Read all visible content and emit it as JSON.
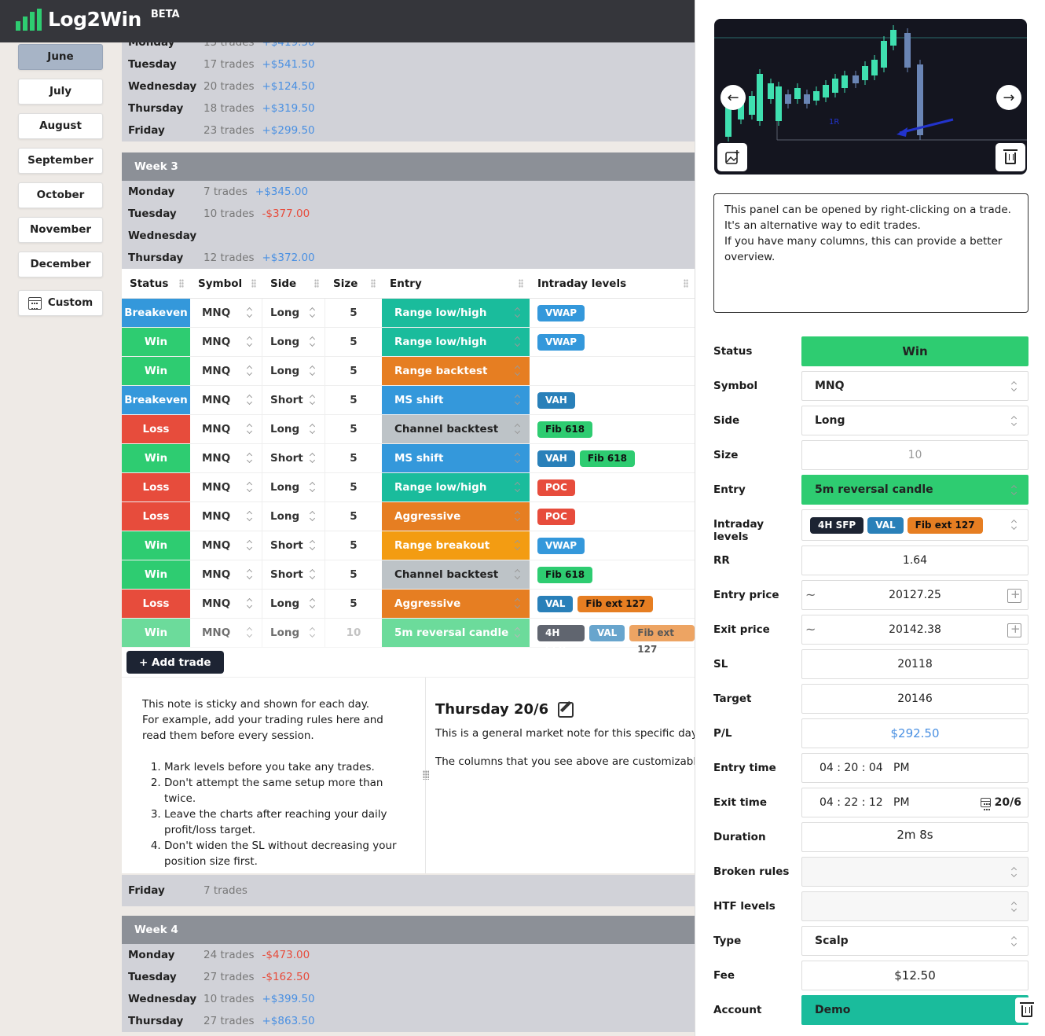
{
  "app": {
    "name": "Log2Win",
    "badge": "BETA"
  },
  "months": [
    {
      "label": "June",
      "active": true
    },
    {
      "label": "July",
      "active": false
    },
    {
      "label": "August",
      "active": false
    },
    {
      "label": "September",
      "active": false
    },
    {
      "label": "October",
      "active": false
    },
    {
      "label": "November",
      "active": false
    },
    {
      "label": "December",
      "active": false
    }
  ],
  "custom_label": "Custom",
  "week2_days": [
    {
      "day": "Monday",
      "trades": "15 trades",
      "pl": "+$419.50"
    },
    {
      "day": "Tuesday",
      "trades": "17 trades",
      "pl": "+$541.50"
    },
    {
      "day": "Wednesday",
      "trades": "20 trades",
      "pl": "+$124.50"
    },
    {
      "day": "Thursday",
      "trades": "18 trades",
      "pl": "+$319.50"
    },
    {
      "day": "Friday",
      "trades": "23 trades",
      "pl": "+$299.50"
    }
  ],
  "week3": {
    "title": "Week 3",
    "days": [
      {
        "day": "Monday",
        "trades": "7 trades",
        "pl": "+$345.00",
        "neg": false
      },
      {
        "day": "Tuesday",
        "trades": "10 trades",
        "pl": "-$377.00",
        "neg": true
      },
      {
        "day": "Wednesday",
        "trades": "",
        "pl": "",
        "neg": false
      },
      {
        "day": "Thursday",
        "trades": "12 trades",
        "pl": "+$372.00",
        "neg": false
      }
    ]
  },
  "table": {
    "headers": [
      "Status",
      "Symbol",
      "Side",
      "Size",
      "Entry",
      "Intraday levels"
    ],
    "rows": [
      {
        "status": "Breakeven",
        "symbol": "MNQ",
        "side": "Long",
        "size": "5",
        "entry": "Range low/high",
        "levels": [
          "VWAP"
        ]
      },
      {
        "status": "Win",
        "symbol": "MNQ",
        "side": "Long",
        "size": "5",
        "entry": "Range low/high",
        "levels": [
          "VWAP"
        ]
      },
      {
        "status": "Win",
        "symbol": "MNQ",
        "side": "Long",
        "size": "5",
        "entry": "Range backtest",
        "levels": []
      },
      {
        "status": "Breakeven",
        "symbol": "MNQ",
        "side": "Short",
        "size": "5",
        "entry": "MS shift",
        "levels": [
          "VAH"
        ]
      },
      {
        "status": "Loss",
        "symbol": "MNQ",
        "side": "Long",
        "size": "5",
        "entry": "Channel backtest",
        "levels": [
          "Fib 618"
        ]
      },
      {
        "status": "Win",
        "symbol": "MNQ",
        "side": "Short",
        "size": "5",
        "entry": "MS shift",
        "levels": [
          "VAH",
          "Fib 618"
        ]
      },
      {
        "status": "Loss",
        "symbol": "MNQ",
        "side": "Long",
        "size": "5",
        "entry": "Range low/high",
        "levels": [
          "POC"
        ]
      },
      {
        "status": "Loss",
        "symbol": "MNQ",
        "side": "Long",
        "size": "5",
        "entry": "Aggressive",
        "levels": [
          "POC"
        ]
      },
      {
        "status": "Win",
        "symbol": "MNQ",
        "side": "Short",
        "size": "5",
        "entry": "Range breakout",
        "levels": [
          "VWAP"
        ]
      },
      {
        "status": "Win",
        "symbol": "MNQ",
        "side": "Short",
        "size": "5",
        "entry": "Channel backtest",
        "levels": [
          "Fib 618"
        ]
      },
      {
        "status": "Loss",
        "symbol": "MNQ",
        "side": "Long",
        "size": "5",
        "entry": "Aggressive",
        "levels": [
          "VAL",
          "Fib ext 127"
        ]
      },
      {
        "status": "Win",
        "symbol": "MNQ",
        "side": "Long",
        "size": "10",
        "entry": "5m reversal candle",
        "levels": [
          "4H SFP",
          "VAL",
          "Fib ext 127"
        ],
        "faded": true
      }
    ]
  },
  "add_trade_label": "+ Add trade",
  "sticky_note": {
    "intro": [
      "This note is sticky and shown for each day.",
      "For example, add your trading rules here and read them before every session."
    ],
    "rules": [
      "Mark levels before you take any trades.",
      "Don't attempt the same setup more than twice.",
      "Leave the charts after reaching your daily profit/loss target.",
      "Don't widen the SL without decreasing your position size first."
    ]
  },
  "day_note": {
    "title": "Thursday 20/6",
    "lines": [
      "This is a general market note for this specific day.",
      "The columns that you see above are customizable. Y"
    ]
  },
  "friday": {
    "day": "Friday",
    "trades": "7 trades"
  },
  "week4": {
    "title": "Week 4",
    "days": [
      {
        "day": "Monday",
        "trades": "24 trades",
        "pl": "-$473.00",
        "neg": true
      },
      {
        "day": "Tuesday",
        "trades": "27 trades",
        "pl": "-$162.50",
        "neg": true
      },
      {
        "day": "Wednesday",
        "trades": "10 trades",
        "pl": "+$399.50",
        "neg": false
      },
      {
        "day": "Thursday",
        "trades": "27 trades",
        "pl": "+$863.50",
        "neg": false
      }
    ]
  },
  "panel": {
    "note": "This panel can be opened by right-clicking on a trade. It's an alternative way to edit trades.\nIf you have many columns, this can provide a better overview.",
    "fields": {
      "status": {
        "label": "Status",
        "value": "Win"
      },
      "symbol": {
        "label": "Symbol",
        "value": "MNQ"
      },
      "side": {
        "label": "Side",
        "value": "Long"
      },
      "size": {
        "label": "Size",
        "value": "10"
      },
      "entry": {
        "label": "Entry",
        "value": "5m reversal candle"
      },
      "levels": {
        "label": "Intraday levels",
        "tags": [
          "4H SFP",
          "VAL",
          "Fib ext 127"
        ]
      },
      "rr": {
        "label": "RR",
        "value": "1.64"
      },
      "entry_price": {
        "label": "Entry price",
        "value": "20127.25"
      },
      "exit_price": {
        "label": "Exit price",
        "value": "20142.38"
      },
      "sl": {
        "label": "SL",
        "value": "20118"
      },
      "target": {
        "label": "Target",
        "value": "20146"
      },
      "pl": {
        "label": "P/L",
        "value": "$292.50"
      },
      "entry_time": {
        "label": "Entry time",
        "value": "04 : 20 : 04   PM"
      },
      "exit_time": {
        "label": "Exit time",
        "value": "04 : 22 : 12   PM",
        "date": "20/6"
      },
      "duration": {
        "label": "Duration",
        "value": "2m 8s"
      },
      "broken_rules": {
        "label": "Broken rules",
        "value": ""
      },
      "htf_levels": {
        "label": "HTF levels",
        "value": ""
      },
      "type": {
        "label": "Type",
        "value": "Scalp"
      },
      "fee": {
        "label": "Fee",
        "value": "$12.50"
      },
      "account": {
        "label": "Account",
        "value": "Demo"
      }
    }
  },
  "colors": {
    "win": "#2ecc71",
    "loss": "#e74c3c",
    "breakeven": "#3498db",
    "range_low_high": "#1abc9c",
    "range_backtest": "#e67e22",
    "ms_shift": "#3498db",
    "channel_backtest": "#bdc3c7",
    "aggressive": "#e67e22",
    "range_breakout": "#f39c12",
    "reversal_candle": "#2ecc71",
    "VWAP": "#3498db",
    "VAH": "#2980b9",
    "VAL": "#2980b9",
    "POC": "#e74c3c",
    "Fib 618": "#2ecc71",
    "Fib ext 127": "#e67e22",
    "4H SFP": "#1d2433",
    "account": "#1abc9c"
  }
}
